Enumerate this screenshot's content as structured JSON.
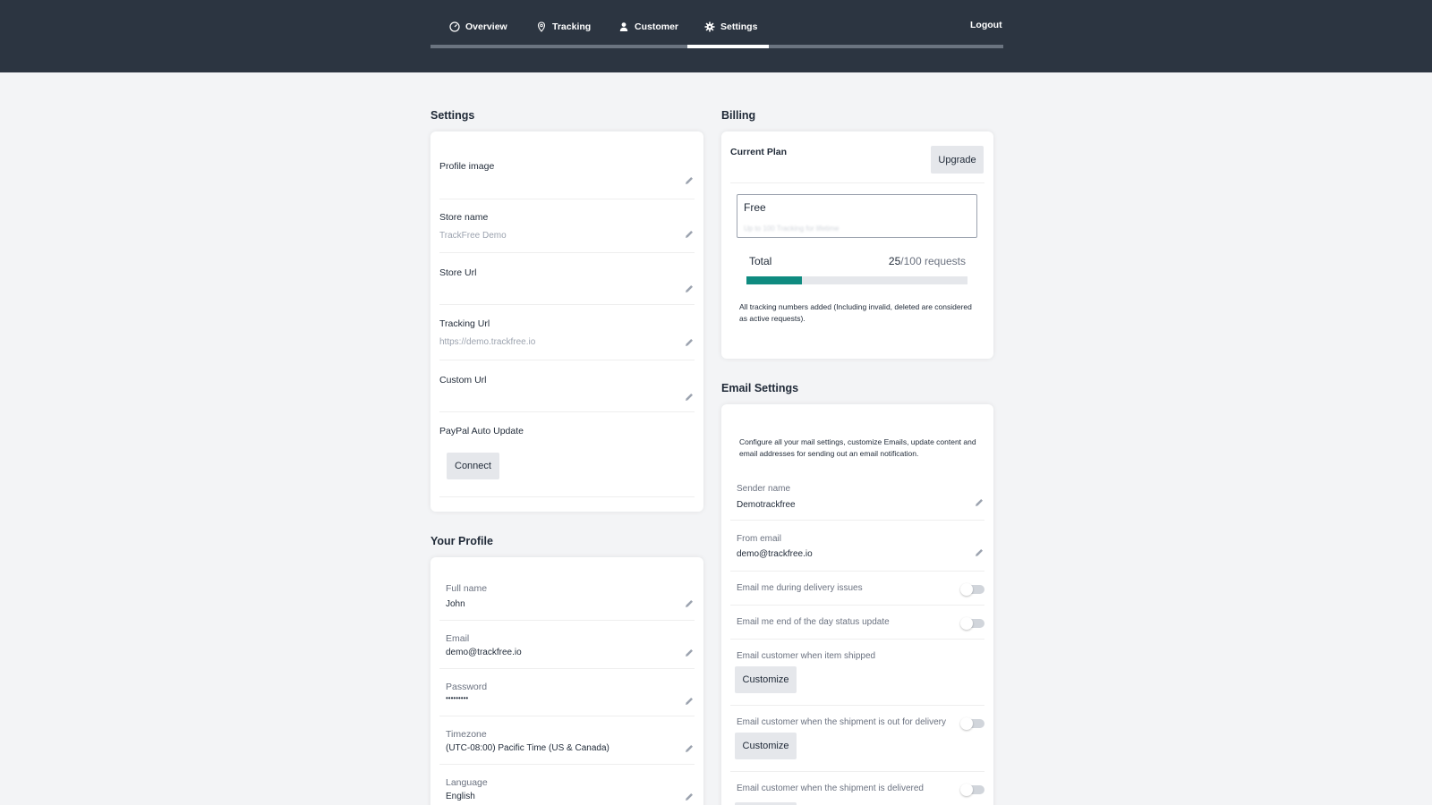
{
  "nav": {
    "items": [
      {
        "label": "Overview",
        "icon": "dashboard-icon"
      },
      {
        "label": "Tracking",
        "icon": "map-pin-icon"
      },
      {
        "label": "Customer",
        "icon": "user-icon"
      },
      {
        "label": "Settings",
        "icon": "gear-icon",
        "active": true
      }
    ],
    "logout": "Logout"
  },
  "settings": {
    "title": "Settings",
    "profile_image": "Profile image",
    "store_name": {
      "label": "Store name",
      "value": "TrackFree Demo"
    },
    "store_url": {
      "label": "Store Url"
    },
    "tracking_url": {
      "label": "Tracking Url",
      "value": "https://demo.trackfree.io"
    },
    "custom_url": {
      "label": "Custom Url"
    },
    "paypal": {
      "label": "PayPal Auto Update",
      "button": "Connect"
    }
  },
  "profile": {
    "title": "Your Profile",
    "full_name": {
      "label": "Full name",
      "value": "John"
    },
    "email": {
      "label": "Email",
      "value": "demo@trackfree.io"
    },
    "password": {
      "label": "Password",
      "value": "•••••••••"
    },
    "timezone": {
      "label": "Timezone",
      "value": "(UTC-08:00) Pacific Time (US & Canada)"
    },
    "language": {
      "label": "Language",
      "value": "English"
    }
  },
  "billing": {
    "title": "Billing",
    "current_plan": "Current Plan",
    "upgrade": "Upgrade",
    "plan_name": "Free",
    "plan_desc": "Up to 100 Tracking for lifetime",
    "total_label": "Total",
    "used": "25",
    "limit_text": "/100 requests",
    "progress_fraction": 0.25,
    "note": "All tracking numbers added (Including invalid, deleted are considered as active requests)."
  },
  "email": {
    "title": "Email Settings",
    "intro": "Configure all your mail settings, customize Emails, update content and email addresses for sending out an email notification.",
    "sender": {
      "label": "Sender name",
      "value": "Demotrackfree"
    },
    "from": {
      "label": "From email",
      "value": "demo@trackfree.io"
    },
    "delivery_issues": "Email me during delivery issues",
    "end_of_day": "Email me end of the day status update",
    "item_shipped": "Email customer when item shipped",
    "out_for_delivery": "Email customer when the shipment is out for delivery",
    "delivered": "Email customer when the shipment is delivered",
    "customize": "Customize"
  },
  "colors": {
    "topbar": "#2c3541",
    "progress": "#0f8b80"
  }
}
